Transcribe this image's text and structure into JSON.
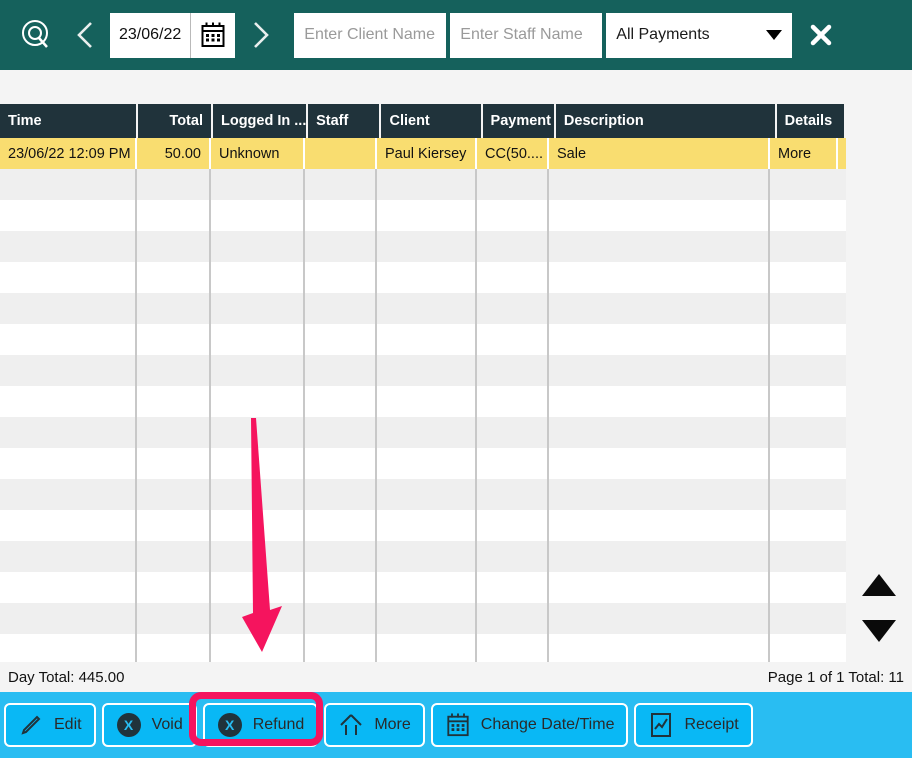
{
  "topbar": {
    "search_icon": "search-icon",
    "prev_icon": "chevron-left-icon",
    "next_icon": "chevron-right-icon",
    "date_value": "23/06/22",
    "calendar_icon": "calendar-icon",
    "client_placeholder": "Enter Client Name",
    "client_value": "",
    "staff_placeholder": "Enter Staff Name",
    "staff_value": "",
    "payment_filter_value": "All Payments",
    "payment_filter_options": [
      "All Payments"
    ],
    "close_icon": "close-icon",
    "background_color": "#15615c"
  },
  "table": {
    "columns": [
      {
        "key": "time",
        "label": "Time",
        "align": "left"
      },
      {
        "key": "total",
        "label": "Total",
        "align": "right"
      },
      {
        "key": "logged_in",
        "label": "Logged In ...",
        "align": "left"
      },
      {
        "key": "staff",
        "label": "Staff",
        "align": "left"
      },
      {
        "key": "client",
        "label": "Client",
        "align": "left"
      },
      {
        "key": "payment",
        "label": "Payment",
        "align": "left"
      },
      {
        "key": "description",
        "label": "Description",
        "align": "left"
      },
      {
        "key": "details",
        "label": "Details",
        "align": "left"
      }
    ],
    "header_background": "#20333b",
    "selected_row_color": "#f9dd70",
    "rows": [
      {
        "selected": true,
        "time": "23/06/22 12:09 PM",
        "total": "50.00",
        "logged_in": "Unknown",
        "staff": "",
        "client": "Paul Kiersey",
        "payment": "CC(50....",
        "description": "Sale",
        "details": "More"
      }
    ],
    "empty_row_count": 16,
    "scroll_up_icon": "triangle-up-icon",
    "scroll_down_icon": "triangle-down-icon"
  },
  "status": {
    "day_total": "Day Total: 445.00",
    "page_info": "Page 1 of 1  Total: 11"
  },
  "toolbar": {
    "background_color": "#29bdf2",
    "buttons": [
      {
        "label": "Edit",
        "icon": "pencil-icon"
      },
      {
        "label": "Void",
        "icon": "x-circle-icon"
      },
      {
        "label": "Refund",
        "icon": "x-circle-icon"
      },
      {
        "label": "More",
        "icon": "arrow-up-icon"
      },
      {
        "label": "Change Date/Time",
        "icon": "calendar-icon"
      },
      {
        "label": "Receipt",
        "icon": "chart-document-icon"
      }
    ]
  },
  "annotations": {
    "arrow_color": "#f5145e",
    "highlight_color": "#f5145e",
    "highlight_target": "Refund"
  }
}
